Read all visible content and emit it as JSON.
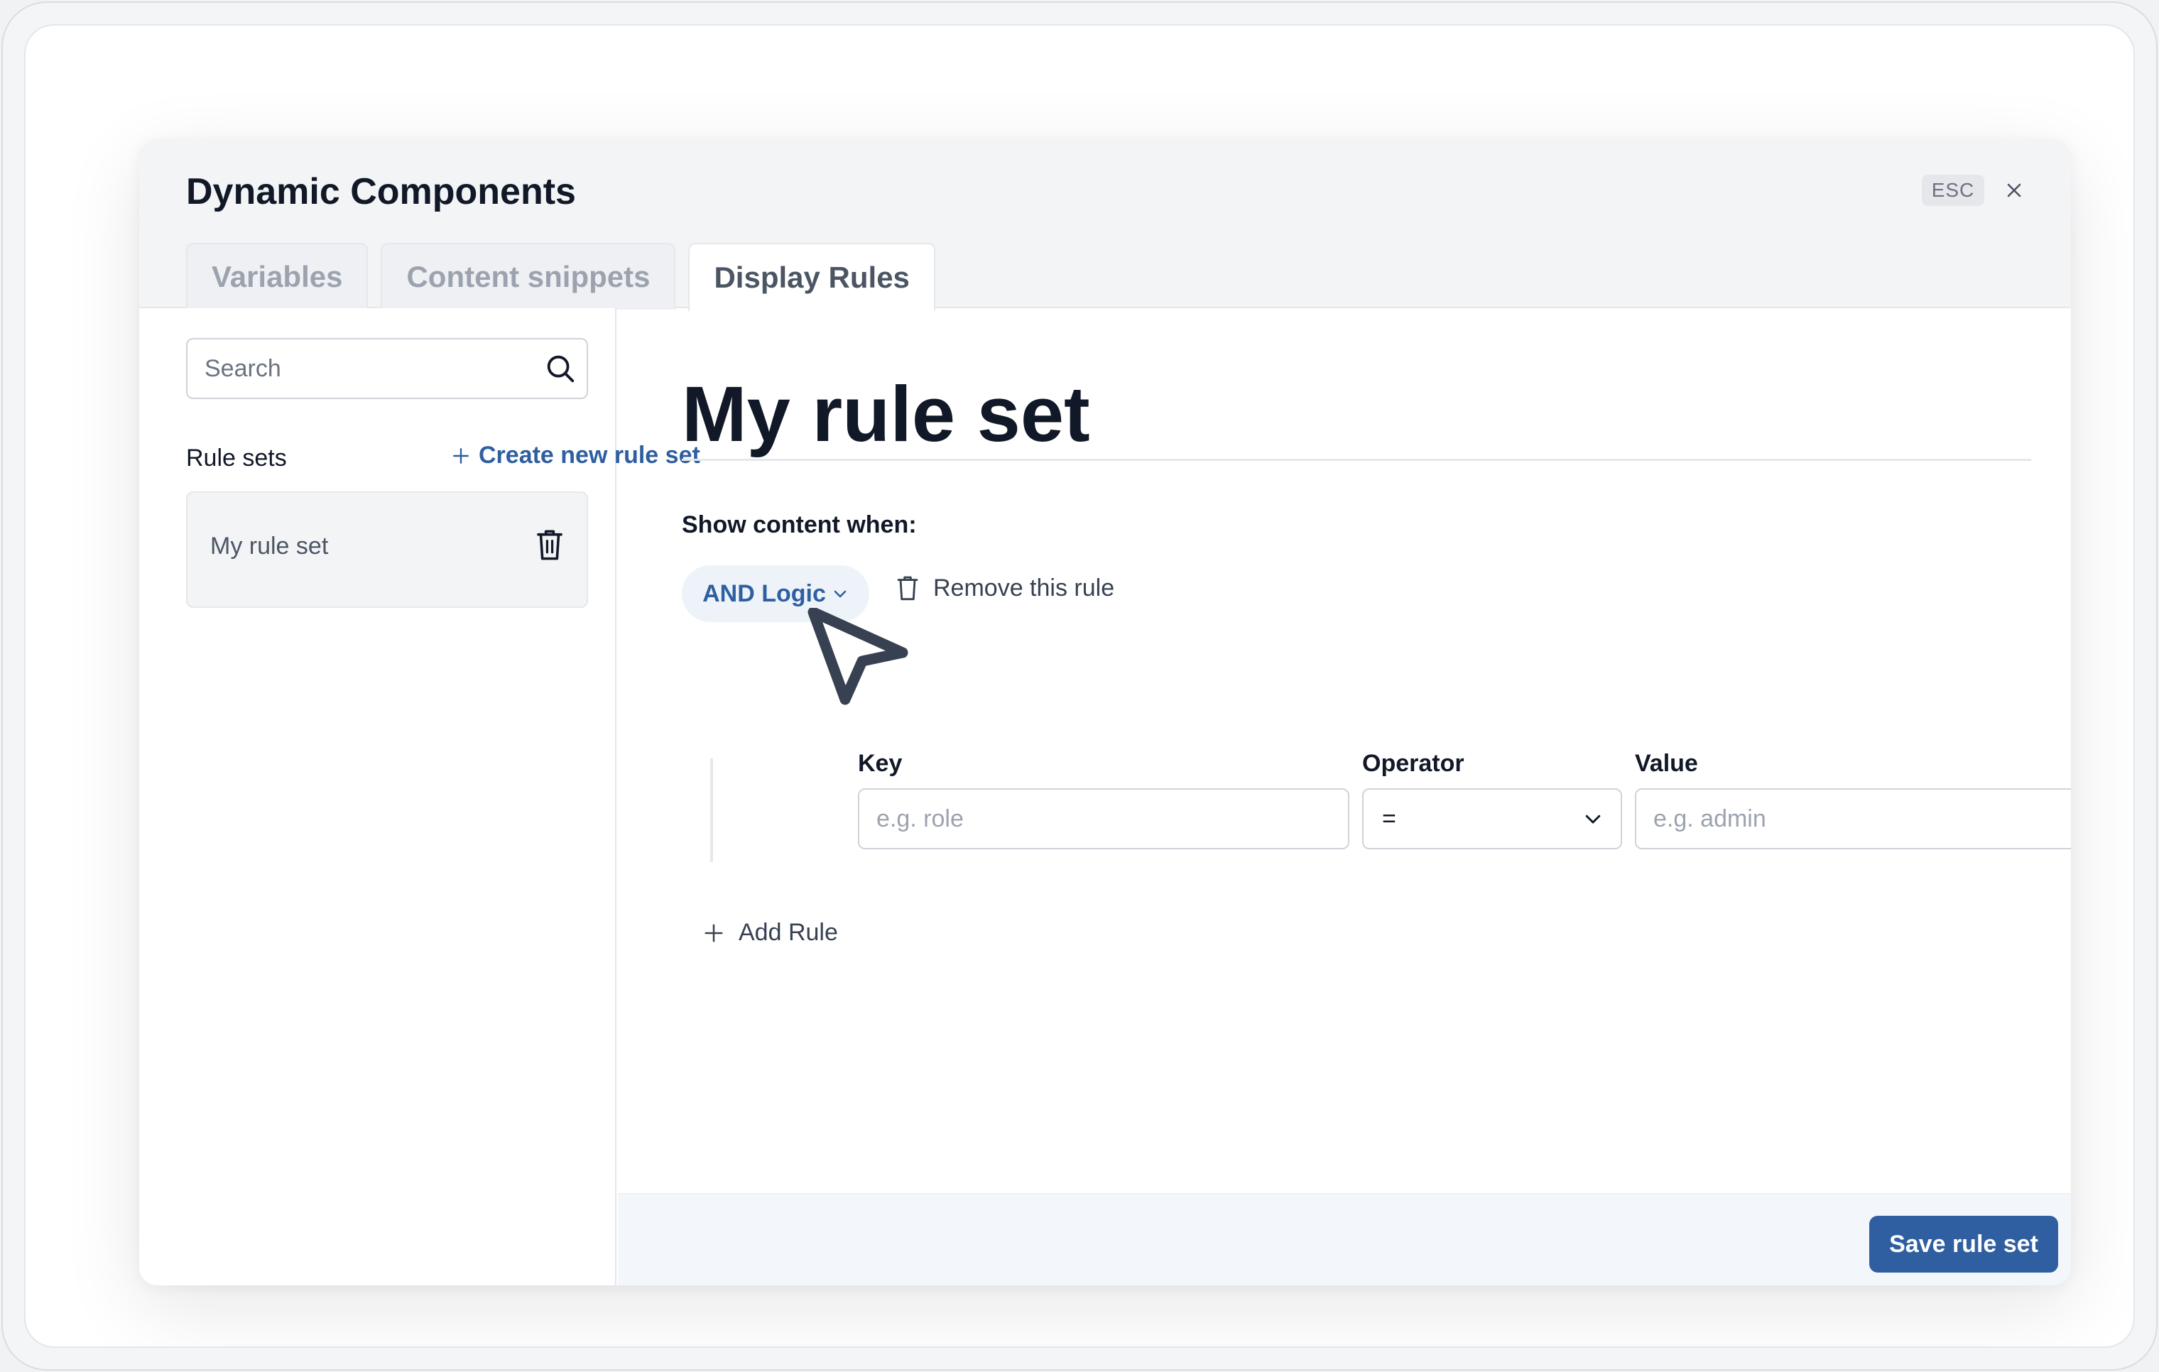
{
  "modal": {
    "title": "Dynamic Components",
    "esc_label": "ESC"
  },
  "tabs": [
    {
      "label": "Variables",
      "active": false
    },
    {
      "label": "Content snippets",
      "active": false
    },
    {
      "label": "Display Rules",
      "active": true
    }
  ],
  "sidebar": {
    "search_placeholder": "Search",
    "rule_sets_label": "Rule sets",
    "create_link": "Create new rule set",
    "items": [
      {
        "label": "My rule set"
      }
    ]
  },
  "main": {
    "rule_set_name": "My rule set",
    "show_content_when": "Show content when:",
    "logic_label": "AND Logic",
    "remove_rule_label": "Remove this rule",
    "rule": {
      "key_label": "Key",
      "key_placeholder": "e.g. role",
      "operator_label": "Operator",
      "operator_value": "=",
      "value_label": "Value",
      "value_placeholder": "e.g. admin"
    },
    "add_rule_label": "Add Rule"
  },
  "footer": {
    "save_label": "Save rule set"
  },
  "colors": {
    "accent": "#2f5fa0",
    "accent_light": "#eef3fa",
    "header_bg": "#f3f4f6",
    "footer_bg": "#f3f7fb"
  }
}
